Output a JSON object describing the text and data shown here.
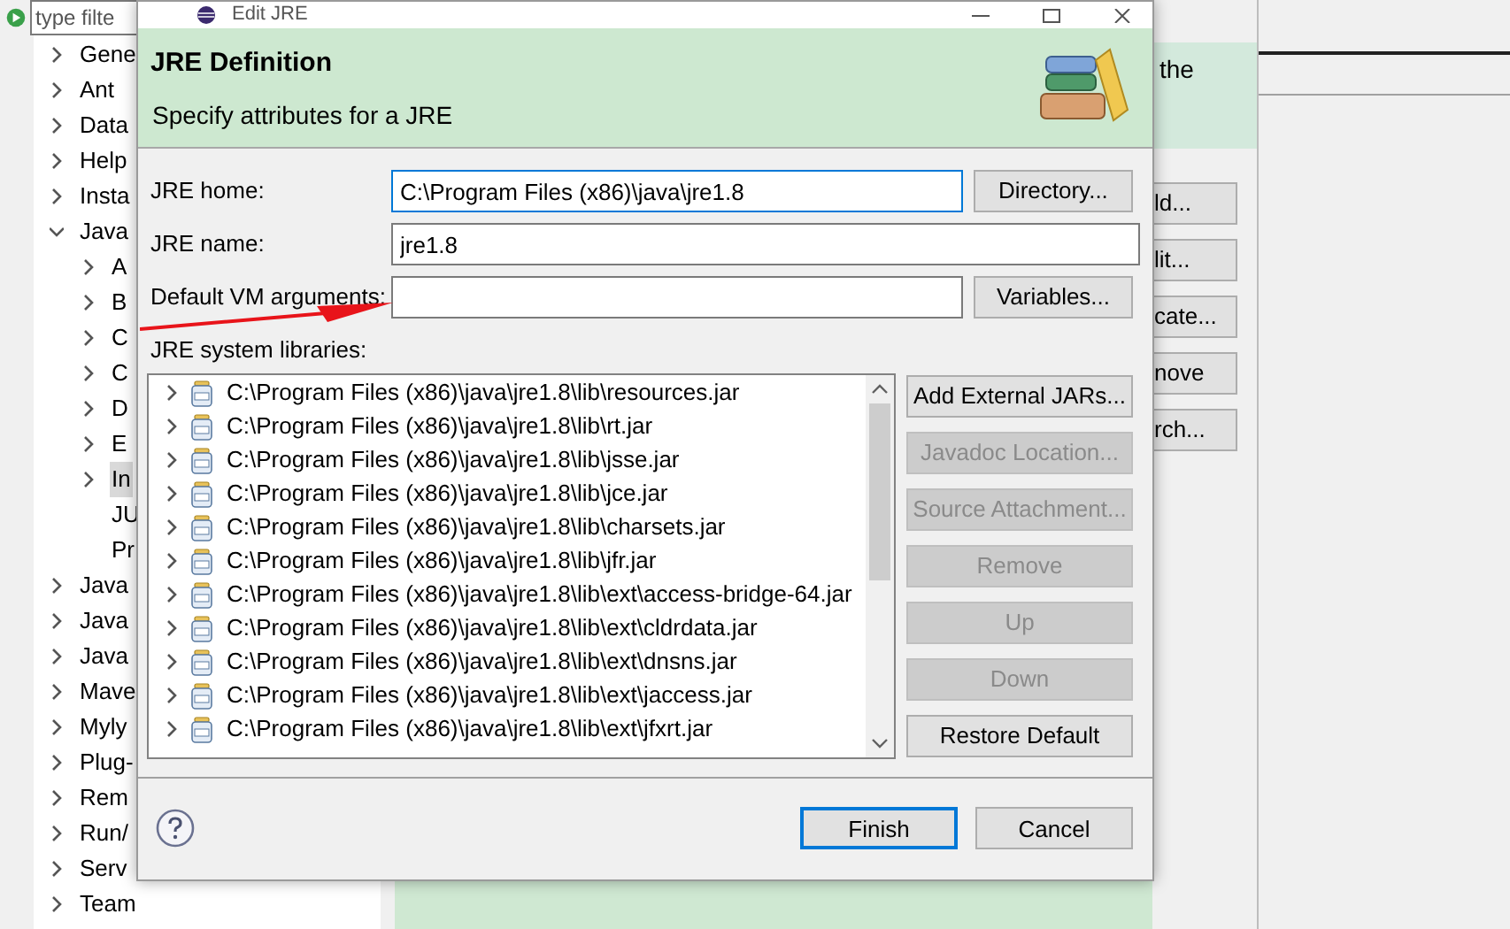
{
  "preferences": {
    "filter": {
      "placeholder": "type filte"
    },
    "tree": [
      {
        "label": "Gene",
        "kind": "folder",
        "expanded": false,
        "selected": false
      },
      {
        "label": "Ant",
        "kind": "folder",
        "expanded": false,
        "selected": false
      },
      {
        "label": "Data",
        "kind": "folder",
        "expanded": false,
        "selected": false
      },
      {
        "label": "Help",
        "kind": "folder",
        "expanded": false,
        "selected": false
      },
      {
        "label": "Insta",
        "kind": "folder",
        "expanded": false,
        "selected": false
      },
      {
        "label": "Java",
        "kind": "folder",
        "expanded": true,
        "selected": false,
        "children": [
          {
            "label": "A",
            "kind": "folder",
            "expanded": false,
            "selected": false
          },
          {
            "label": "B",
            "kind": "folder",
            "expanded": false,
            "selected": false
          },
          {
            "label": "C",
            "kind": "folder",
            "expanded": false,
            "selected": false
          },
          {
            "label": "C",
            "kind": "folder",
            "expanded": false,
            "selected": false
          },
          {
            "label": "D",
            "kind": "folder",
            "expanded": false,
            "selected": false
          },
          {
            "label": "E",
            "kind": "folder",
            "expanded": false,
            "selected": false
          },
          {
            "label": "In",
            "kind": "folder",
            "expanded": false,
            "selected": true
          },
          {
            "label": "JU",
            "kind": "leaf",
            "selected": false
          },
          {
            "label": "Pr",
            "kind": "leaf",
            "selected": false
          }
        ]
      },
      {
        "label": "Java",
        "kind": "folder",
        "expanded": false,
        "selected": false
      },
      {
        "label": "Java",
        "kind": "folder",
        "expanded": false,
        "selected": false
      },
      {
        "label": "Java",
        "kind": "folder",
        "expanded": false,
        "selected": false
      },
      {
        "label": "Mave",
        "kind": "folder",
        "expanded": false,
        "selected": false
      },
      {
        "label": "Myly",
        "kind": "folder",
        "expanded": false,
        "selected": false
      },
      {
        "label": "Plug-",
        "kind": "folder",
        "expanded": false,
        "selected": false
      },
      {
        "label": "Rem",
        "kind": "folder",
        "expanded": false,
        "selected": false
      },
      {
        "label": "Run/",
        "kind": "folder",
        "expanded": false,
        "selected": false
      },
      {
        "label": "Serv",
        "kind": "folder",
        "expanded": false,
        "selected": false
      },
      {
        "label": "Team",
        "kind": "folder",
        "expanded": false,
        "selected": false
      }
    ],
    "side_text": "the",
    "buttons": [
      "ld...",
      "lit...",
      "cate...",
      "nove",
      "rch..."
    ]
  },
  "dialog": {
    "title": "Edit JRE",
    "header": {
      "title": "JRE Definition",
      "subtitle": "Specify attributes for a JRE"
    },
    "fields": [
      {
        "label": "JRE home:",
        "value": "C:\\Program Files (x86)\\java\\jre1.8",
        "button": "Directory...",
        "focused": true
      },
      {
        "label": "JRE name:",
        "value": "jre1.8",
        "focused": false
      },
      {
        "label": "Default VM arguments:",
        "button": "Variables...",
        "focused": false
      }
    ],
    "libraries": {
      "label": "JRE system libraries:",
      "items": [
        "C:\\Program Files (x86)\\java\\jre1.8\\lib\\resources.jar",
        "C:\\Program Files (x86)\\java\\jre1.8\\lib\\rt.jar",
        "C:\\Program Files (x86)\\java\\jre1.8\\lib\\jsse.jar",
        "C:\\Program Files (x86)\\java\\jre1.8\\lib\\jce.jar",
        "C:\\Program Files (x86)\\java\\jre1.8\\lib\\charsets.jar",
        "C:\\Program Files (x86)\\java\\jre1.8\\lib\\jfr.jar",
        "C:\\Program Files (x86)\\java\\jre1.8\\lib\\ext\\access-bridge-64.jar",
        "C:\\Program Files (x86)\\java\\jre1.8\\lib\\ext\\cldrdata.jar",
        "C:\\Program Files (x86)\\java\\jre1.8\\lib\\ext\\dnsns.jar",
        "C:\\Program Files (x86)\\java\\jre1.8\\lib\\ext\\jaccess.jar",
        "C:\\Program Files (x86)\\java\\jre1.8\\lib\\ext\\jfxrt.jar"
      ]
    },
    "library_buttons": [
      {
        "label": "Add External JARs...",
        "disabled": false
      },
      {
        "label": "Javadoc Location...",
        "disabled": true
      },
      {
        "label": "Source Attachment...",
        "disabled": true
      },
      {
        "label": "Remove",
        "disabled": true
      },
      {
        "label": "Up",
        "disabled": true
      },
      {
        "label": "Down",
        "disabled": true
      },
      {
        "label": "Restore Default",
        "disabled": false
      }
    ],
    "buttons": [
      {
        "label": "Finish",
        "default": true
      },
      {
        "label": "Cancel",
        "default": false
      }
    ]
  }
}
